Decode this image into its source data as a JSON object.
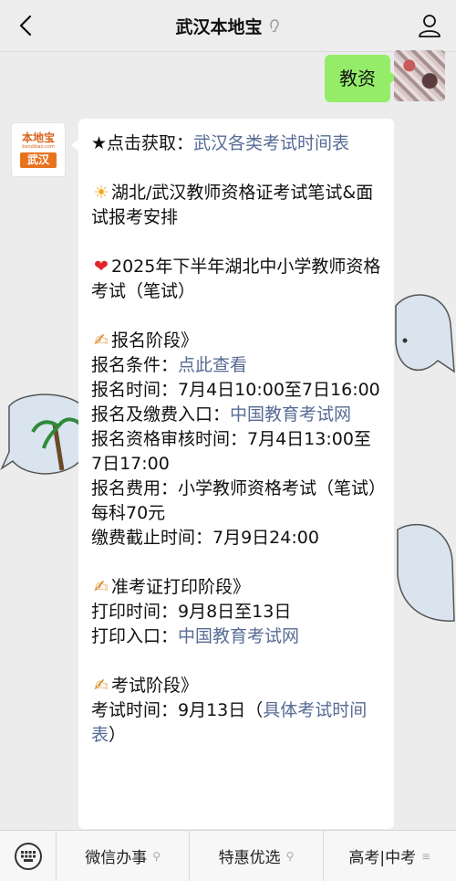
{
  "header": {
    "title": "武汉本地宝"
  },
  "chat": {
    "outgoing_text": "教资",
    "bot_logo": {
      "brand": "本地宝",
      "city": "武汉"
    }
  },
  "message": {
    "l1_prefix": "★点击获取：",
    "l1_link": "武汉各类考试时间表",
    "l2": "湖北/武汉教师资格证考试笔试&面试报考安排",
    "l3": "2025年下半年湖北中小学教师资格考试（笔试）",
    "s1_title": "报名阶段》",
    "cond_label": "报名条件：",
    "cond_link": "点此查看",
    "reg_time": "报名时间：7月4日10:00至7日16:00",
    "pay_label": "报名及缴费入口：",
    "pay_link": "中国教育考试网",
    "review_time": "报名资格审核时间：7月4日13:00至7日17:00",
    "fee": "报名费用：小学教师资格考试（笔试）每科70元",
    "pay_deadline": "缴费截止时间：7月9日24:00",
    "s2_title": "准考证打印阶段》",
    "print_time": "打印时间：9月8日至13日",
    "print_label": "打印入口：",
    "print_link": "中国教育考试网",
    "s3_title": "考试阶段》",
    "exam_prefix": "考试时间：9月13日（",
    "exam_link": "具体考试时间表",
    "exam_suffix": "）"
  },
  "bottom_menu": {
    "items": [
      "微信办事",
      "特惠优选",
      "高考|中考"
    ]
  },
  "icons": {
    "back": "chevron-left-icon",
    "profile": "person-icon",
    "keyboard": "keyboard-icon"
  },
  "colors": {
    "link": "#576b95",
    "bubble_out": "#95ec69",
    "brand_orange": "#e8731f"
  }
}
